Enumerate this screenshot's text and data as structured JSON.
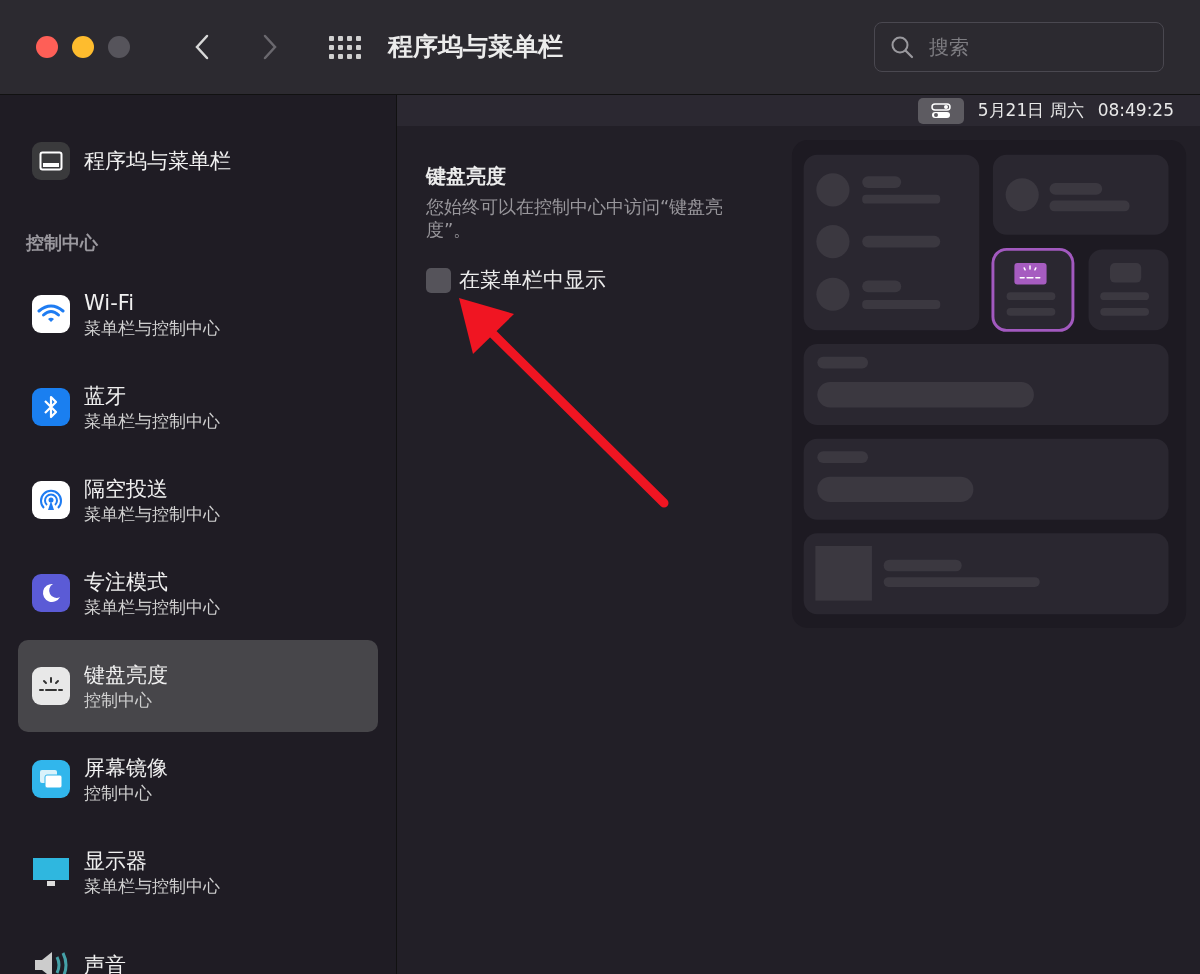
{
  "window": {
    "title": "程序坞与菜单栏",
    "back": {
      "disabled": false
    },
    "forward": {
      "disabled": true
    },
    "search": {
      "placeholder": "搜索"
    }
  },
  "menu_bar": {
    "date": "5月21日 周六",
    "time": "08:49:25"
  },
  "sidebar": {
    "top_items": [
      {
        "kind": "dock",
        "title": "程序坞与菜单栏",
        "selected": false
      }
    ],
    "section": "控制中心",
    "items": [
      {
        "kind": "wifi",
        "title": "Wi-Fi",
        "subtitle": "菜单栏与控制中心",
        "selected": false
      },
      {
        "kind": "bluetooth",
        "title": "蓝牙",
        "subtitle": "菜单栏与控制中心",
        "selected": false
      },
      {
        "kind": "airdrop",
        "title": "隔空投送",
        "subtitle": "菜单栏与控制中心",
        "selected": false
      },
      {
        "kind": "focus",
        "title": "专注模式",
        "subtitle": "菜单栏与控制中心",
        "selected": false
      },
      {
        "kind": "keyboard",
        "title": "键盘亮度",
        "subtitle": "控制中心",
        "selected": true
      },
      {
        "kind": "mirroring",
        "title": "屏幕镜像",
        "subtitle": "控制中心",
        "selected": false
      },
      {
        "kind": "display",
        "title": "显示器",
        "subtitle": "菜单栏与控制中心",
        "selected": false
      },
      {
        "kind": "sound",
        "title": "声音",
        "selected": false
      }
    ]
  },
  "content": {
    "title": "键盘亮度",
    "description": "您始终可以在控制中心中访问“键盘亮度”。",
    "checkbox": {
      "label": "在菜单栏中显示",
      "checked": false
    }
  }
}
